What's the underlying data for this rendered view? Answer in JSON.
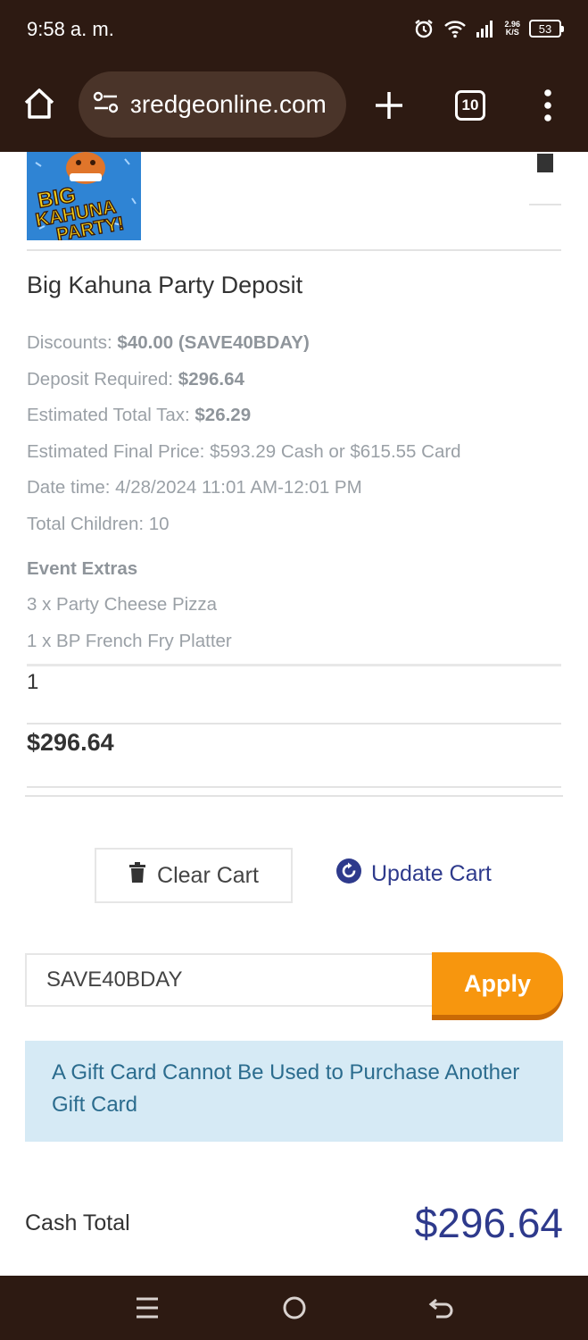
{
  "status_bar": {
    "time": "9:58 a. m.",
    "net_speed_value": "2.96",
    "net_speed_unit": "K/S",
    "battery": "53"
  },
  "browser": {
    "url": "ɜredgeonline.com",
    "tab_count": "10"
  },
  "cart_item": {
    "title": "Big Kahuna Party Deposit",
    "discounts_label": "Discounts:",
    "discounts_value": "$40.00 (SAVE40BDAY)",
    "deposit_label": "Deposit Required:",
    "deposit_value": "$296.64",
    "tax_label": "Estimated Total Tax:",
    "tax_value": "$26.29",
    "final_price": "Estimated Final Price: $593.29 Cash or $615.55 Card",
    "date_time": "Date time: 4/28/2024 11:01 AM-12:01 PM",
    "total_children": "Total Children: 10",
    "extras_heading": "Event Extras",
    "extras": [
      "3 x Party Cheese Pizza",
      "1 x BP French Fry Platter"
    ],
    "quantity": "1",
    "price": "$296.64"
  },
  "actions": {
    "clear_cart": "Clear Cart",
    "update_cart": "Update Cart"
  },
  "coupon": {
    "value": "SAVE40BDAY",
    "apply_label": "Apply"
  },
  "notice": "A Gift Card Cannot Be Used to Purchase Another Gift Card",
  "totals": {
    "cash_label": "Cash Total",
    "cash_value": "$296.64"
  },
  "colors": {
    "system_bar": "#2d1a12",
    "accent_orange": "#f7960e",
    "link_blue": "#2e3a8c",
    "notice_bg": "#d6eaf5"
  }
}
